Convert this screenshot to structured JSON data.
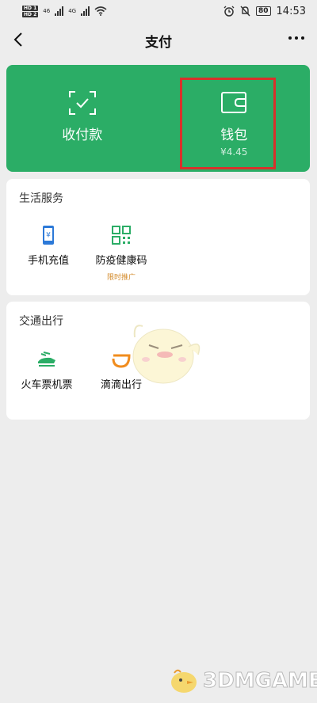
{
  "status_bar": {
    "hd1": "HD 1",
    "hd2": "HD 2",
    "net1": "46",
    "net2": "4G",
    "battery": "80",
    "time": "14:53"
  },
  "nav": {
    "title": "支付"
  },
  "pay_card": {
    "receive_label": "收付款",
    "wallet_label": "钱包",
    "wallet_balance": "¥4.45",
    "highlight_color": "#d8312b",
    "bg_color": "#2bad66"
  },
  "life_services": {
    "title": "生活服务",
    "items": [
      {
        "label": "手机充值",
        "icon": "phone-yuan-icon"
      },
      {
        "label": "防疫健康码",
        "icon": "qr-code-icon",
        "tag": "限时推广"
      }
    ]
  },
  "transport": {
    "title": "交通出行",
    "items": [
      {
        "label": "火车票机票",
        "icon": "train-icon"
      },
      {
        "label": "滴滴出行",
        "icon": "didi-icon"
      }
    ]
  },
  "watermark": {
    "text": "3DMGAME"
  }
}
